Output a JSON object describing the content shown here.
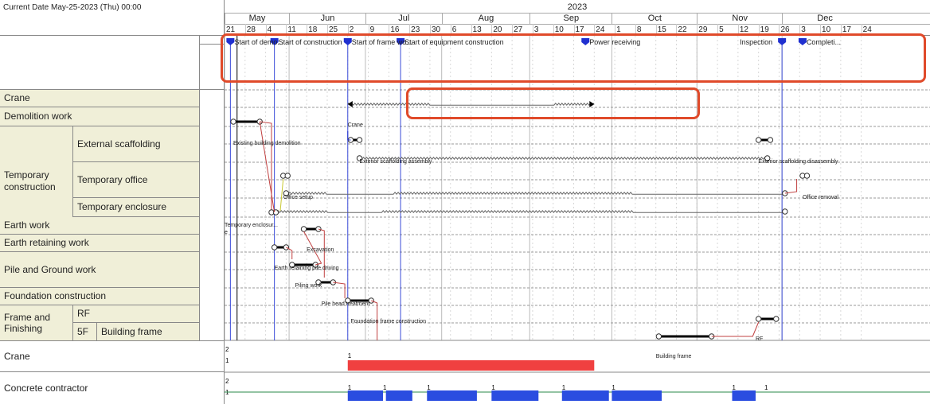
{
  "header": {
    "current_date": "Current Date May-25-2023 (Thu) 00:00"
  },
  "timeline": {
    "year": "2023",
    "months": [
      {
        "label": "May",
        "start": 21,
        "end": 43
      },
      {
        "label": "Jun",
        "start": 43,
        "end": 69
      },
      {
        "label": "Jul",
        "start": 69,
        "end": 95
      },
      {
        "label": "Aug",
        "start": 95,
        "end": 125
      },
      {
        "label": "Sep",
        "start": 125,
        "end": 153
      },
      {
        "label": "Oct",
        "start": 153,
        "end": 182
      },
      {
        "label": "Nov",
        "start": 182,
        "end": 211
      },
      {
        "label": "Dec",
        "start": 211,
        "end": 240
      }
    ],
    "weeks": [
      {
        "d": 21,
        "label": "21"
      },
      {
        "d": 28,
        "label": "28"
      },
      {
        "d": 35,
        "label": "4"
      },
      {
        "d": 42,
        "label": "11"
      },
      {
        "d": 49,
        "label": "18"
      },
      {
        "d": 56,
        "label": "25"
      },
      {
        "d": 63,
        "label": "2"
      },
      {
        "d": 70,
        "label": "9"
      },
      {
        "d": 77,
        "label": "16"
      },
      {
        "d": 84,
        "label": "23"
      },
      {
        "d": 91,
        "label": "30"
      },
      {
        "d": 98,
        "label": "6"
      },
      {
        "d": 105,
        "label": "13"
      },
      {
        "d": 112,
        "label": "20"
      },
      {
        "d": 119,
        "label": "27"
      },
      {
        "d": 126,
        "label": "3"
      },
      {
        "d": 133,
        "label": "10"
      },
      {
        "d": 140,
        "label": "17"
      },
      {
        "d": 147,
        "label": "24"
      },
      {
        "d": 154,
        "label": "1"
      },
      {
        "d": 161,
        "label": "8"
      },
      {
        "d": 168,
        "label": "15"
      },
      {
        "d": 175,
        "label": "22"
      },
      {
        "d": 182,
        "label": "29"
      },
      {
        "d": 189,
        "label": "5"
      },
      {
        "d": 196,
        "label": "12"
      },
      {
        "d": 203,
        "label": "19"
      },
      {
        "d": 210,
        "label": "26"
      },
      {
        "d": 217,
        "label": "3"
      },
      {
        "d": 224,
        "label": "10"
      },
      {
        "d": 231,
        "label": "17"
      },
      {
        "d": 238,
        "label": "24"
      }
    ],
    "today": 25
  },
  "milestones": [
    {
      "label": "Start of demo...",
      "day": 23
    },
    {
      "label": "Start of construction",
      "day": 38
    },
    {
      "label": "Start of frame wo...",
      "day": 63
    },
    {
      "label": "Start of equipment construction",
      "day": 81
    },
    {
      "label": "Power receiving",
      "day": 144
    },
    {
      "label": "Inspection",
      "day": 211
    },
    {
      "label": "Completi...",
      "day": 218
    }
  ],
  "rows": {
    "crane": "Crane",
    "demolition": "Demolition work",
    "temporary": "Temporary construction",
    "external": "External scaffolding",
    "office": "Temporary office",
    "enclosure": "Temporary enclosure",
    "earth": "Earth work",
    "retaining": "Earth retaining work",
    "pile": "Pile and Ground work",
    "foundation": "Foundation construction",
    "frame": "Frame and Finishing",
    "rf": "RF",
    "f5": "5F",
    "bframe": "Building frame"
  },
  "tasks": [
    {
      "label": "Crane",
      "row": "crane"
    },
    {
      "label": "Existing building demolition",
      "row": "demolition"
    },
    {
      "label": "Exterior scaffolding assembly",
      "row": "external"
    },
    {
      "label": "Exterior scaffolding disassembly",
      "row": "external"
    },
    {
      "label": "Office setup",
      "row": "office"
    },
    {
      "label": "Office removal",
      "row": "office"
    },
    {
      "label": "Temporary enclosur...",
      "row": "enclosure"
    },
    {
      "label": "e",
      "row": "enclosure"
    },
    {
      "label": "Excavation",
      "row": "earth"
    },
    {
      "label": "Earth retaining pile driving",
      "row": "retaining"
    },
    {
      "label": "Piling work",
      "row": "pile"
    },
    {
      "label": "Pile head treatment",
      "row": "pile"
    },
    {
      "label": "Foundation frame construction",
      "row": "foundation"
    },
    {
      "label": "RF",
      "row": "rf"
    },
    {
      "label": "Building frame",
      "row": "bframe"
    }
  ],
  "resources": [
    {
      "label": "Crane",
      "color": "#f04040",
      "ticks": [
        "2",
        "1"
      ],
      "bar_labels": [
        "1"
      ]
    },
    {
      "label": "Concrete contractor",
      "color": "#2a4de0",
      "ticks": [
        "2",
        "1"
      ],
      "bar_labels": [
        "1",
        "1",
        "1",
        "1",
        "1",
        "1",
        "1",
        "1"
      ]
    }
  ],
  "colors": {
    "highlight": "#e04a2a",
    "arrow_red": "#c03030",
    "arrow_blue": "#2030d0",
    "label_bg": "#f0efd8"
  }
}
